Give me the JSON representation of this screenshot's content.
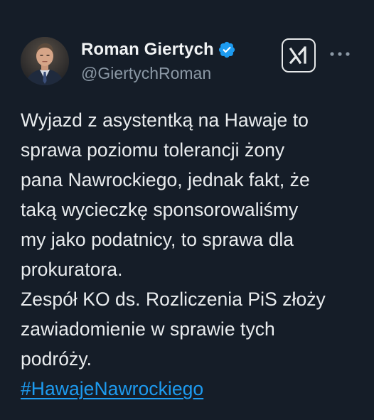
{
  "author": {
    "display_name": "Roman Giertych",
    "handle": "@GiertychRoman",
    "verified": true,
    "avatar_icon": "profile-photo"
  },
  "toolbar": {
    "xai_icon": "grok-xai-icon",
    "more_icon": "more-options-icon"
  },
  "tweet": {
    "lines": [
      "Wyjazd z asystentką na Hawaje to",
      "sprawa poziomu tolerancji żony",
      "pana Nawrockiego, jednak fakt, że",
      "taką wycieczkę sponsorowaliśmy",
      "my jako podatnicy, to sprawa dla",
      "prokuratora.",
      "Zespół KO ds. Rozliczenia PiS złoży",
      "zawiadomienie w sprawie tych",
      "podróży."
    ],
    "hashtag": "#HawajeNawrockiego"
  },
  "colors": {
    "background": "#151d28",
    "text": "#e9ecee",
    "secondary_text": "#8b98a5",
    "link": "#1d9bf0",
    "verified_badge": "#1d9bf0"
  }
}
